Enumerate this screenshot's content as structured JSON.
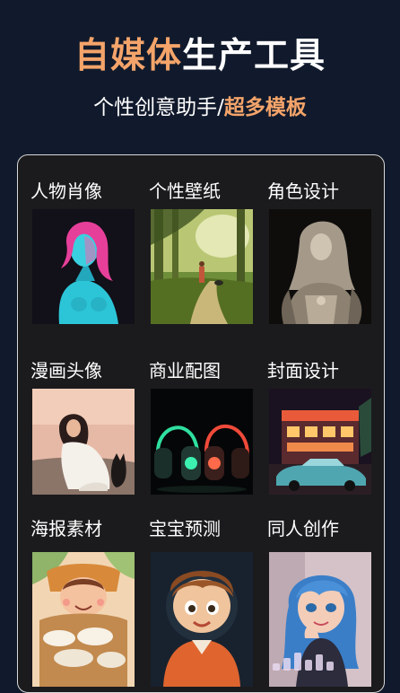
{
  "header": {
    "title_accent": "自媒体",
    "title_rest": "生产工具",
    "subtitle_plain": "个性创意助手/",
    "subtitle_accent": "超多模板"
  },
  "colors": {
    "background": "#111a2c",
    "accent": "#f4a46a",
    "panel": "#1b1b1d",
    "panel_border": "#d8d8d8"
  },
  "categories": [
    {
      "label": "人物肖像",
      "icon": "neon-portrait-thumbnail"
    },
    {
      "label": "个性壁纸",
      "icon": "forest-path-thumbnail"
    },
    {
      "label": "角色设计",
      "icon": "hooded-warrior-thumbnail"
    },
    {
      "label": "漫画头像",
      "icon": "girl-with-cat-thumbnail"
    },
    {
      "label": "商业配图",
      "icon": "headphones-thumbnail"
    },
    {
      "label": "封面设计",
      "icon": "retro-car-diner-thumbnail"
    },
    {
      "label": "海报素材",
      "icon": "baby-in-basket-thumbnail"
    },
    {
      "label": "宝宝预测",
      "icon": "cartoon-boy-thumbnail"
    },
    {
      "label": "同人创作",
      "icon": "anime-girl-thumbnail"
    }
  ]
}
